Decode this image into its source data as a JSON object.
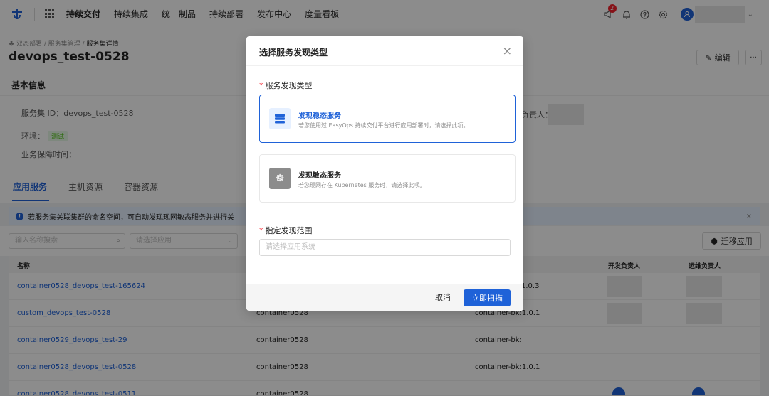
{
  "nav": {
    "items": [
      "持续交付",
      "持续集成",
      "统一制品",
      "持续部署",
      "发布中心",
      "度量看板"
    ],
    "notification_count": "2"
  },
  "page": {
    "breadcrumbs": [
      "双态部署",
      "服务集管理",
      "服务集详情"
    ],
    "title": "devops_test-0528",
    "edit_label": "编辑",
    "more_label": "···"
  },
  "basic": {
    "section_title": "基本信息",
    "service_set_id": "服务集 ID：devops_test-0528",
    "env_label": "环境：",
    "env_tag": "测试",
    "guarantee_label": "业务保障时间：",
    "owner_label": "负责人："
  },
  "tabs": [
    "应用服务",
    "主机资源",
    "容器资源"
  ],
  "alert": {
    "text": "若服务集关联集群的命名空间，可自动发现现网敏态服务并进行关",
    "close": "×"
  },
  "toolbar": {
    "search_placeholder": "输入名称搜索",
    "app_placeholder": "请选择应用",
    "migrate_label": "迁移应用"
  },
  "table": {
    "headers": {
      "name": "名称",
      "dev_owner": "开发负责人",
      "ops_owner": "运维负责人"
    },
    "rows": [
      {
        "name": "container0528_devops_test-165624",
        "container": "",
        "image": "1.0.3"
      },
      {
        "name": "custom_devops_test-0528",
        "container": "container0528",
        "image": "container-bk:1.0.1"
      },
      {
        "name": "container0529_devops_test-29",
        "container": "container0528",
        "image": "container-bk:"
      },
      {
        "name": "container0528_devops_test-0528",
        "container": "container0528",
        "image": "container-bk:1.0.1"
      },
      {
        "name": "container0528_devops_test-0511",
        "container": "container0528",
        "image": ""
      }
    ]
  },
  "modal": {
    "title": "选择服务发现类型",
    "close": "×",
    "type_label": "服务发现类型",
    "options": [
      {
        "title": "发现稳态服务",
        "desc": "若您使用过 EasyOps 持续交付平台进行应用部署时，请选择此项。"
      },
      {
        "title": "发现敏态服务",
        "desc": "若您现网存在 Kubernetes 服务时，请选择此项。"
      }
    ],
    "scope_label": "指定发现范围",
    "scope_placeholder": "请选择应用系统",
    "cancel_label": "取消",
    "scan_label": "立即扫描"
  },
  "colors": {
    "primary": "#1f62d8",
    "danger": "#f5222d",
    "success": "#52c41a"
  }
}
